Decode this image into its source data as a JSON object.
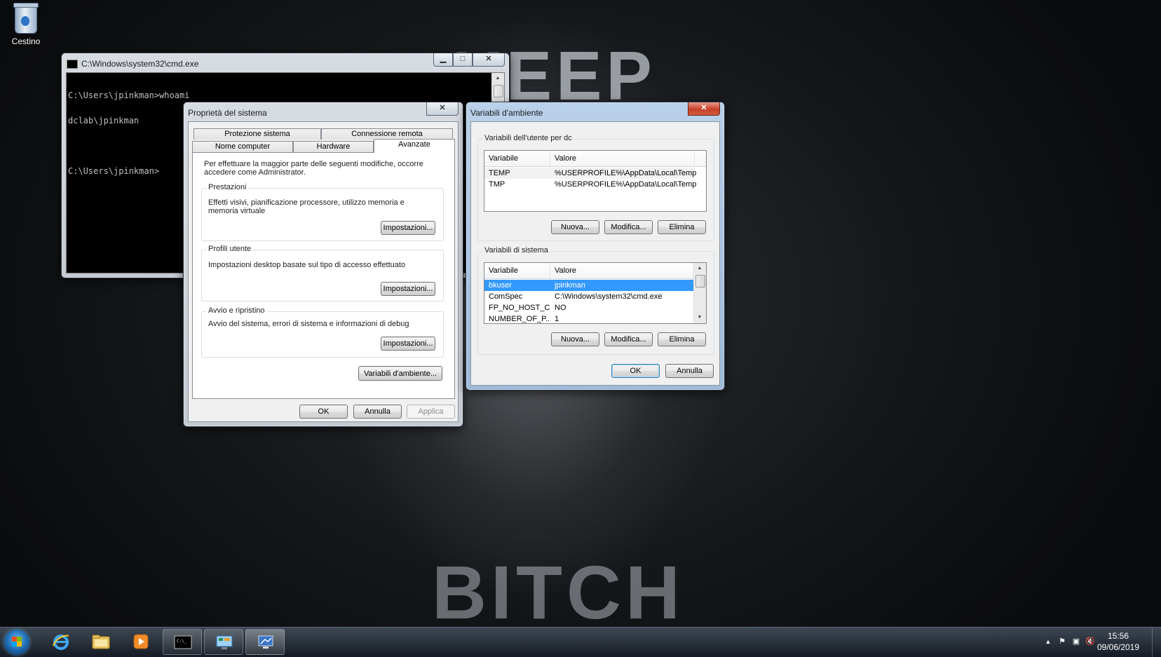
{
  "desktop": {
    "wallpaper_top_word": "KEEP",
    "wallpaper_bottom_word": "BITCH",
    "recycle_bin_label": "Cestino"
  },
  "cmd_window": {
    "title": "C:\\Windows\\system32\\cmd.exe",
    "lines": [
      "C:\\Users\\jpinkman>whoami",
      "dclab\\jpinkman",
      "",
      "C:\\Users\\jpinkman>"
    ],
    "min_glyph": "▁",
    "max_glyph": "□",
    "close_glyph": "✕"
  },
  "system_properties": {
    "title": "Proprietà del sistema",
    "close_glyph": "✕",
    "tabs_row1": [
      "Protezione sistema",
      "Connessione remota"
    ],
    "tabs_row2": [
      "Nome computer",
      "Hardware",
      "Avanzate"
    ],
    "active_tab": "Avanzate",
    "intro_text": "Per effettuare la maggior parte delle seguenti modifiche, occorre accedere come Administrator.",
    "groups": {
      "performance": {
        "label": "Prestazioni",
        "text": "Effetti visivi, pianificazione processore, utilizzo memoria e memoria virtuale",
        "button": "Impostazioni..."
      },
      "user_profiles": {
        "label": "Profili utente",
        "text": "Impostazioni desktop basate sul tipo di accesso effettuato",
        "button": "Impostazioni..."
      },
      "startup_recovery": {
        "label": "Avvio e ripristino",
        "text": "Avvio del sistema, errori di sistema e informazioni di debug",
        "button": "Impostazioni..."
      }
    },
    "env_vars_button": "Variabili d'ambiente...",
    "ok_button": "OK",
    "cancel_button": "Annulla",
    "apply_button": "Applica"
  },
  "environment_variables": {
    "title": "Variabili d'ambiente",
    "close_glyph": "✕",
    "user_section": {
      "label": "Variabili dell'utente per dc",
      "columns": [
        "Variabile",
        "Valore"
      ],
      "rows": [
        {
          "name": "TEMP",
          "value": "%USERPROFILE%\\AppData\\Local\\Temp"
        },
        {
          "name": "TMP",
          "value": "%USERPROFILE%\\AppData\\Local\\Temp"
        }
      ],
      "new_button": "Nuova...",
      "edit_button": "Modifica...",
      "delete_button": "Elimina"
    },
    "system_section": {
      "label": "Variabili di sistema",
      "columns": [
        "Variabile",
        "Valore"
      ],
      "rows": [
        {
          "name": "bkuser",
          "value": "jpinkman",
          "selected": true
        },
        {
          "name": "ComSpec",
          "value": "C:\\Windows\\system32\\cmd.exe"
        },
        {
          "name": "FP_NO_HOST_C...",
          "value": "NO"
        },
        {
          "name": "NUMBER_OF_P...",
          "value": "1"
        }
      ],
      "new_button": "Nuova...",
      "edit_button": "Modifica...",
      "delete_button": "Elimina"
    },
    "ok_button": "OK",
    "cancel_button": "Annulla"
  },
  "taskbar": {
    "clock_time": "15:56",
    "clock_date": "09/06/2019",
    "tray_expand_glyph": "▲",
    "pinned": [
      "internet-explorer",
      "windows-explorer",
      "media-player"
    ],
    "open": [
      "cmd",
      "control-panel",
      "system-properties"
    ]
  }
}
